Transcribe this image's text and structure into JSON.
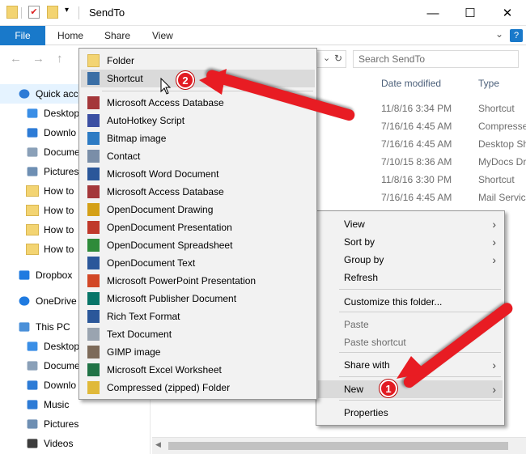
{
  "window": {
    "title": "SendTo",
    "minimize": "—",
    "maximize": "☐",
    "close": "✕"
  },
  "ribbon": {
    "tabs": [
      "File",
      "Home",
      "Share",
      "View"
    ],
    "help": "?"
  },
  "search": {
    "placeholder": "Search SendTo"
  },
  "sidebar": {
    "items": [
      {
        "label": "Quick acc",
        "icon": "star-icon"
      },
      {
        "label": "Desktop",
        "icon": "desktop-icon"
      },
      {
        "label": "Downlo",
        "icon": "download-icon"
      },
      {
        "label": "Docume",
        "icon": "documents-icon"
      },
      {
        "label": "Pictures",
        "icon": "pictures-icon"
      },
      {
        "label": "How to",
        "icon": "folder-icon"
      },
      {
        "label": "How to",
        "icon": "folder-icon"
      },
      {
        "label": "How to",
        "icon": "folder-icon"
      },
      {
        "label": "How to",
        "icon": "folder-icon"
      },
      {
        "label": "Dropbox",
        "icon": "dropbox-icon"
      },
      {
        "label": "OneDrive",
        "icon": "onedrive-icon"
      },
      {
        "label": "This PC",
        "icon": "computer-icon"
      },
      {
        "label": "Desktop",
        "icon": "desktop-icon"
      },
      {
        "label": "Docume",
        "icon": "documents-icon"
      },
      {
        "label": "Downlo",
        "icon": "download-icon"
      },
      {
        "label": "Music",
        "icon": "music-icon"
      },
      {
        "label": "Pictures",
        "icon": "pictures-icon"
      },
      {
        "label": "Videos",
        "icon": "videos-icon"
      }
    ]
  },
  "files": {
    "columns": {
      "date": "Date modified",
      "type": "Type"
    },
    "rows": [
      {
        "date": "11/8/16 3:34 PM",
        "type": "Shortcut"
      },
      {
        "date": "7/16/16 4:45 AM",
        "type": "Compresse"
      },
      {
        "date": "7/16/16 4:45 AM",
        "type": "Desktop Sh"
      },
      {
        "date": "7/10/15 8:36 AM",
        "type": "MyDocs Dr"
      },
      {
        "date": "11/8/16 3:30 PM",
        "type": "Shortcut"
      },
      {
        "date": "7/16/16 4:45 AM",
        "type": "Mail Servic"
      }
    ]
  },
  "new_menu": {
    "items": [
      {
        "label": "Folder",
        "icon": "folder-icon",
        "color": "#f3d472"
      },
      {
        "label": "Shortcut",
        "icon": "shortcut-icon",
        "color": "#3a6ea5"
      },
      {
        "label": "Microsoft Access Database",
        "icon": "access-icon",
        "color": "#a4373a"
      },
      {
        "label": "AutoHotkey Script",
        "icon": "ahk-icon",
        "color": "#3b4fa3"
      },
      {
        "label": "Bitmap image",
        "icon": "bitmap-icon",
        "color": "#2d7bc4"
      },
      {
        "label": "Contact",
        "icon": "contact-icon",
        "color": "#7a8ea8"
      },
      {
        "label": "Microsoft Word Document",
        "icon": "word-icon",
        "color": "#2b579a"
      },
      {
        "label": "Microsoft Access Database",
        "icon": "access-icon",
        "color": "#a4373a"
      },
      {
        "label": "OpenDocument Drawing",
        "icon": "odg-icon",
        "color": "#d4a017"
      },
      {
        "label": "OpenDocument Presentation",
        "icon": "odp-icon",
        "color": "#c0392b"
      },
      {
        "label": "OpenDocument Spreadsheet",
        "icon": "ods-icon",
        "color": "#2e8b3a"
      },
      {
        "label": "OpenDocument Text",
        "icon": "odt-icon",
        "color": "#2b579a"
      },
      {
        "label": "Microsoft PowerPoint Presentation",
        "icon": "powerpoint-icon",
        "color": "#d24726"
      },
      {
        "label": "Microsoft Publisher Document",
        "icon": "publisher-icon",
        "color": "#077568"
      },
      {
        "label": "Rich Text Format",
        "icon": "rtf-icon",
        "color": "#2b579a"
      },
      {
        "label": "Text Document",
        "icon": "text-icon",
        "color": "#9aa4b0"
      },
      {
        "label": "GIMP image",
        "icon": "gimp-icon",
        "color": "#7d6b5a"
      },
      {
        "label": "Microsoft Excel Worksheet",
        "icon": "excel-icon",
        "color": "#217346"
      },
      {
        "label": "Compressed (zipped) Folder",
        "icon": "zip-icon",
        "color": "#e0b93a"
      }
    ]
  },
  "context_menu": {
    "items": [
      {
        "label": "View",
        "submenu": true
      },
      {
        "label": "Sort by",
        "submenu": true
      },
      {
        "label": "Group by",
        "submenu": true
      },
      {
        "label": "Refresh"
      },
      {
        "label": "Customize this folder..."
      },
      {
        "label": "Paste",
        "disabled": true
      },
      {
        "label": "Paste shortcut",
        "disabled": true
      },
      {
        "label": "Share with",
        "submenu": true
      },
      {
        "label": "New",
        "submenu": true,
        "highlighted": true
      },
      {
        "label": "Properties"
      }
    ]
  },
  "annotations": {
    "badge1": "1",
    "badge2": "2",
    "arrow_color": "#e81c23"
  }
}
